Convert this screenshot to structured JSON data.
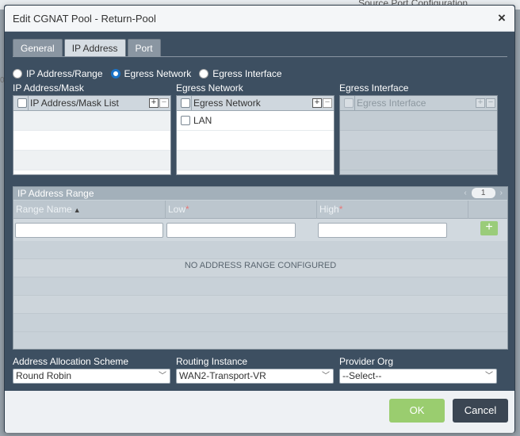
{
  "background": {
    "header_text": "Source Port Configuration"
  },
  "dialog": {
    "title": "Edit CGNAT Pool - Return-Pool",
    "close_symbol": "×"
  },
  "tabs": [
    {
      "label": "General",
      "active": false
    },
    {
      "label": "IP Address",
      "active": true
    },
    {
      "label": "Port",
      "active": false
    }
  ],
  "source_type": {
    "options": [
      "IP Address/Range",
      "Egress Network",
      "Egress Interface"
    ],
    "selected": "Egress Network"
  },
  "ip_mask": {
    "section_label": "IP Address/Mask",
    "column": "IP Address/Mask List",
    "rows": []
  },
  "egress_network": {
    "section_label": "Egress Network",
    "column": "Egress Network",
    "rows": [
      "LAN"
    ]
  },
  "egress_interface": {
    "section_label": "Egress Interface",
    "column": "Egress Interface",
    "rows": []
  },
  "ip_range": {
    "section_label": "IP Address Range",
    "page": "1",
    "columns": [
      {
        "label": "Range Name",
        "required": false
      },
      {
        "label": "Low",
        "required": true
      },
      {
        "label": "High",
        "required": true
      }
    ],
    "empty_message": "NO ADDRESS RANGE CONFIGURED"
  },
  "form": {
    "allocation_label": "Address Allocation Scheme",
    "allocation_value": "Round Robin",
    "routing_label": "Routing Instance",
    "routing_value": "WAN2-Transport-VR",
    "provider_label": "Provider Org",
    "provider_value": "--Select--"
  },
  "footer": {
    "ok_label": "OK",
    "cancel_label": "Cancel"
  },
  "colors": {
    "dialog_bg": "#3d4f61",
    "ok_green": "#9acd6f",
    "cancel_dark": "#3b4653",
    "radio_blue": "#1a73c8"
  }
}
